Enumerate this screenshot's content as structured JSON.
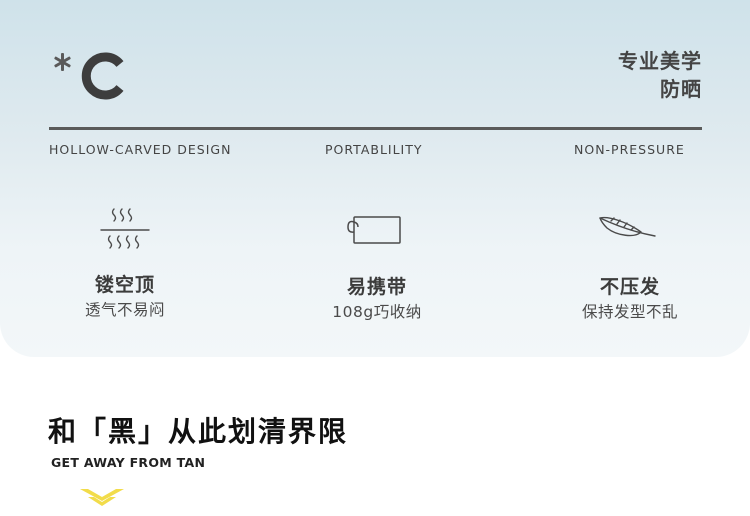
{
  "header": {
    "logo_text": "*C",
    "tagline_line1": "专业美学",
    "tagline_line2": "防晒"
  },
  "features": [
    {
      "en": "HOLLOW-CARVED DESIGN",
      "title": "镂空顶",
      "subtitle": "透气不易闷",
      "icon": "heat-waves-icon"
    },
    {
      "en": "PORTABLILITY",
      "title": "易携带",
      "subtitle": "108g巧收纳",
      "icon": "folded-hat-icon"
    },
    {
      "en": "NON-PRESSURE",
      "title": "不压发",
      "subtitle": "保持发型不乱",
      "icon": "feather-icon"
    }
  ],
  "section": {
    "headline": "和「黑」从此划清界限",
    "headline_en": "GET AWAY FROM TAN"
  },
  "colors": {
    "panel_top": "#cfe2ea",
    "panel_bottom": "#f3f7f9",
    "text_dark": "#3a3a3a",
    "accent_yellow": "#f2dc4a"
  }
}
